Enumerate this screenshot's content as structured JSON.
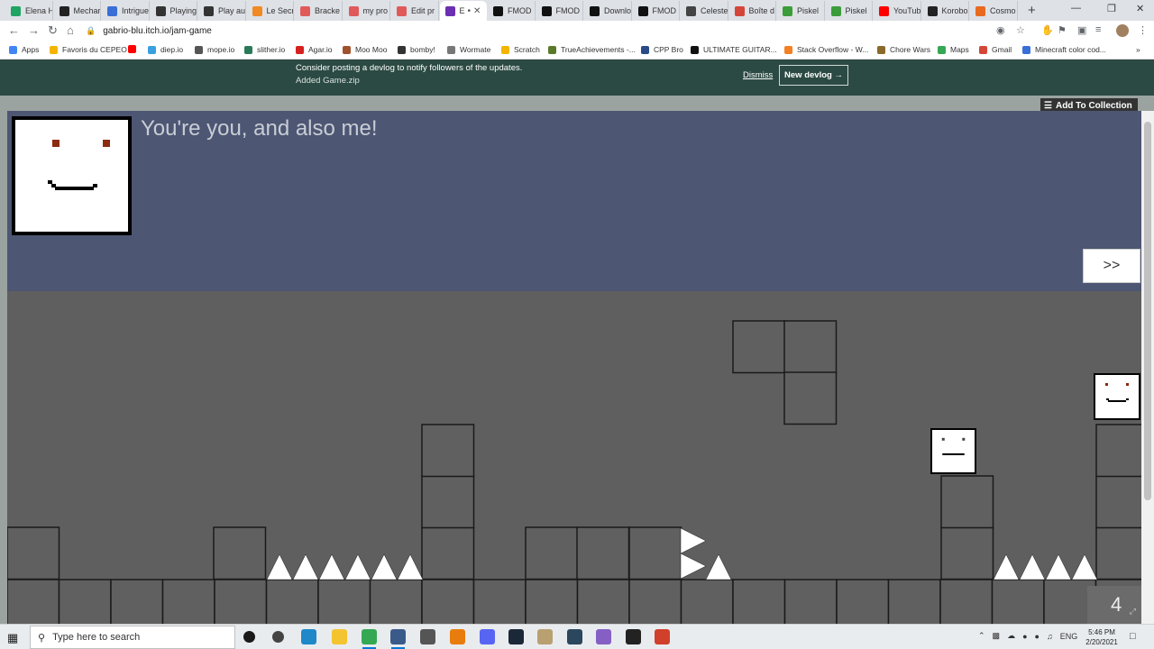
{
  "browser": {
    "tabs": [
      {
        "label": "Elena H",
        "color": "#1fa463"
      },
      {
        "label": "Mechar",
        "color": "#222222"
      },
      {
        "label": "Intrigue",
        "color": "#3a6fd8"
      },
      {
        "label": "Playing",
        "color": "#333333"
      },
      {
        "label": "Play au",
        "color": "#333333"
      },
      {
        "label": "Le Secr",
        "color": "#f08a24"
      },
      {
        "label": "Bracke",
        "color": "#e05a5a"
      },
      {
        "label": "my pro",
        "color": "#e05a5a"
      },
      {
        "label": "Edit pr",
        "color": "#e05a5a"
      },
      {
        "label": "E",
        "color": "#6b2fb3"
      },
      {
        "label": "FMOD",
        "color": "#111111"
      },
      {
        "label": "FMOD",
        "color": "#111111"
      },
      {
        "label": "Downlo",
        "color": "#111111"
      },
      {
        "label": "FMOD",
        "color": "#111111"
      },
      {
        "label": "Celeste",
        "color": "#444444"
      },
      {
        "label": "Boîte d",
        "color": "#d44638"
      },
      {
        "label": "Piskel",
        "color": "#3a9d3a"
      },
      {
        "label": "Piskel",
        "color": "#3a9d3a"
      },
      {
        "label": "YouTub",
        "color": "#ff0000"
      },
      {
        "label": "Korobo",
        "color": "#222222"
      },
      {
        "label": "Cosmo",
        "color": "#e86a1f"
      }
    ],
    "new_tab_label": "+",
    "url": "gabrio-blu.itch.io/jam-game",
    "bookmarks": [
      {
        "label": "Apps",
        "color": "#4285f4"
      },
      {
        "label": "Favoris du CEPEO",
        "color": "#f4b400"
      },
      {
        "label": "",
        "color": "#ff0000"
      },
      {
        "label": "diep.io",
        "color": "#3aa0e0"
      },
      {
        "label": "mope.io",
        "color": "#555555"
      },
      {
        "label": "slither.io",
        "color": "#2a7a5a"
      },
      {
        "label": "Agar.io",
        "color": "#d62020"
      },
      {
        "label": "Moo Moo",
        "color": "#a0522d"
      },
      {
        "label": "bomby!",
        "color": "#333333"
      },
      {
        "label": "Wormate",
        "color": "#777777"
      },
      {
        "label": "Scratch",
        "color": "#f4b400"
      },
      {
        "label": "TrueAchievements -...",
        "color": "#5a7a2a"
      },
      {
        "label": "CPP Bro",
        "color": "#2a4a8a"
      },
      {
        "label": "ULTIMATE GUITAR...",
        "color": "#111111"
      },
      {
        "label": "Stack Overflow - W...",
        "color": "#f48024"
      },
      {
        "label": "Chore Wars",
        "color": "#8a6a2a"
      },
      {
        "label": "Maps",
        "color": "#34a853"
      },
      {
        "label": "Gmail",
        "color": "#d44638"
      },
      {
        "label": "Minecraft color cod...",
        "color": "#3a6fd8"
      }
    ],
    "more_bookmarks": "»"
  },
  "itch": {
    "notify_message": "Consider posting a devlog to notify followers of the updates.",
    "notify_sub": "Added Game.zip",
    "dismiss_label": "Dismiss",
    "new_devlog_label": "New devlog →",
    "add_to_collection_label": "Add To Collection"
  },
  "game": {
    "dialog_text": "You're you, and also me!",
    "next_label": ">>",
    "counter": "4",
    "colors": {
      "background": "#5f5f5f",
      "dialog": "#4d5672",
      "block": "#606060",
      "block_border": "#1a1a1a",
      "spike": "#ffffff",
      "eye": "#8b2b10"
    }
  },
  "taskbar": {
    "search_placeholder": "Type here to search",
    "lang": "ENG",
    "time": "5:46 PM",
    "date": "2/20/2021",
    "apps": [
      {
        "name": "cortana",
        "color": "#1a1a1a"
      },
      {
        "name": "task-view",
        "color": "#444444"
      },
      {
        "name": "edge",
        "color": "#1e88c9"
      },
      {
        "name": "file-explorer",
        "color": "#f4c430"
      },
      {
        "name": "chrome",
        "color": "#34a853"
      },
      {
        "name": "app-grid",
        "color": "#3a5a8a"
      },
      {
        "name": "app-unity",
        "color": "#555555"
      },
      {
        "name": "blender",
        "color": "#e87d0d"
      },
      {
        "name": "discord",
        "color": "#5865f2"
      },
      {
        "name": "steam",
        "color": "#1b2838"
      },
      {
        "name": "app-tan",
        "color": "#b8a070"
      },
      {
        "name": "steam-alt",
        "color": "#2a475e"
      },
      {
        "name": "visual-studio",
        "color": "#865fc5"
      },
      {
        "name": "app-dark",
        "color": "#222222"
      },
      {
        "name": "app-red",
        "color": "#d0402a"
      }
    ]
  }
}
